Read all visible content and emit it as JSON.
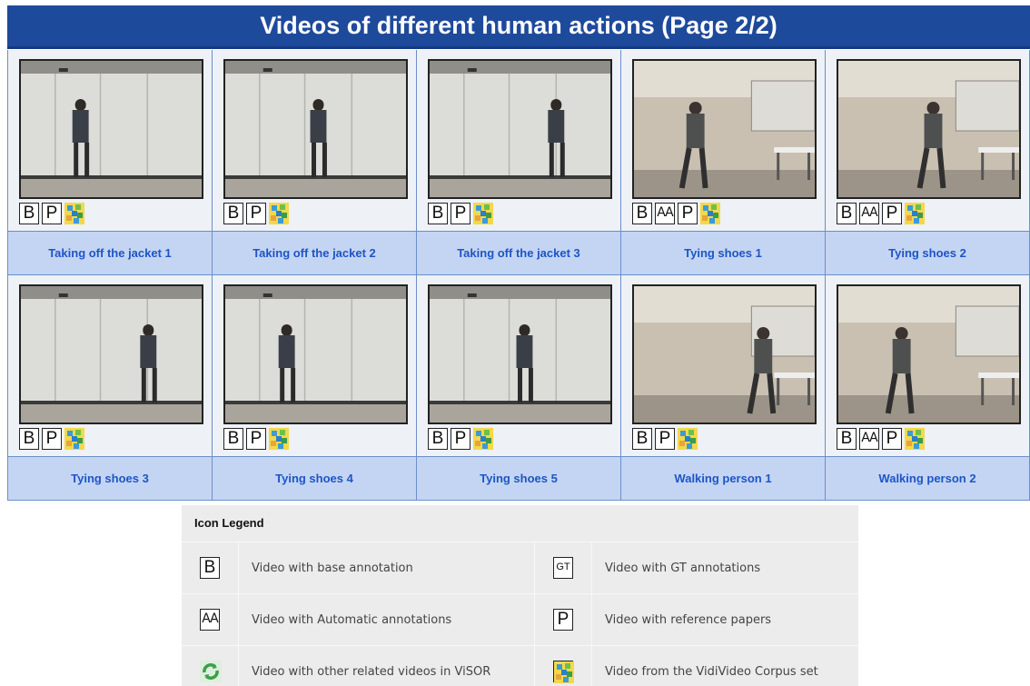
{
  "page": {
    "title": "Videos of different human actions (Page 2/2)"
  },
  "videos": [
    {
      "caption": "Taking off the jacket 1",
      "scene": "wall",
      "icons": [
        "B",
        "P",
        "corpus"
      ]
    },
    {
      "caption": "Taking off the jacket 2",
      "scene": "wall",
      "icons": [
        "B",
        "P",
        "corpus"
      ]
    },
    {
      "caption": "Taking off the jacket 3",
      "scene": "wall",
      "icons": [
        "B",
        "P",
        "corpus"
      ]
    },
    {
      "caption": "Tying shoes 1",
      "scene": "room",
      "icons": [
        "B",
        "AA",
        "P",
        "corpus"
      ]
    },
    {
      "caption": "Tying shoes 2",
      "scene": "room",
      "icons": [
        "B",
        "AA",
        "P",
        "corpus"
      ]
    },
    {
      "caption": "Tying shoes 3",
      "scene": "wall",
      "icons": [
        "B",
        "P",
        "corpus"
      ]
    },
    {
      "caption": "Tying shoes 4",
      "scene": "wall",
      "icons": [
        "B",
        "P",
        "corpus"
      ]
    },
    {
      "caption": "Tying shoes 5",
      "scene": "wall",
      "icons": [
        "B",
        "P",
        "corpus"
      ]
    },
    {
      "caption": "Walking person 1",
      "scene": "room",
      "icons": [
        "B",
        "P",
        "corpus"
      ]
    },
    {
      "caption": "Walking person 2",
      "scene": "room",
      "icons": [
        "B",
        "AA",
        "P",
        "corpus"
      ]
    }
  ],
  "legend": {
    "title": "Icon Legend",
    "rows": [
      [
        {
          "icon": "B",
          "text": "Video with base annotation"
        },
        {
          "icon": "GT",
          "text": "Video with GT annotations"
        }
      ],
      [
        {
          "icon": "AA",
          "text": "Video with Automatic annotations"
        },
        {
          "icon": "P",
          "text": "Video with reference papers"
        }
      ],
      [
        {
          "icon": "related",
          "text": "Video with other related videos in ViSOR"
        },
        {
          "icon": "corpus",
          "text": "Video from the VidiVideo Corpus set"
        }
      ]
    ]
  },
  "colors": {
    "header_bg": "#1e4a9c",
    "caption_bg": "#c4d5f3",
    "caption_text": "#1d55c5",
    "legend_bg": "#ececec"
  }
}
